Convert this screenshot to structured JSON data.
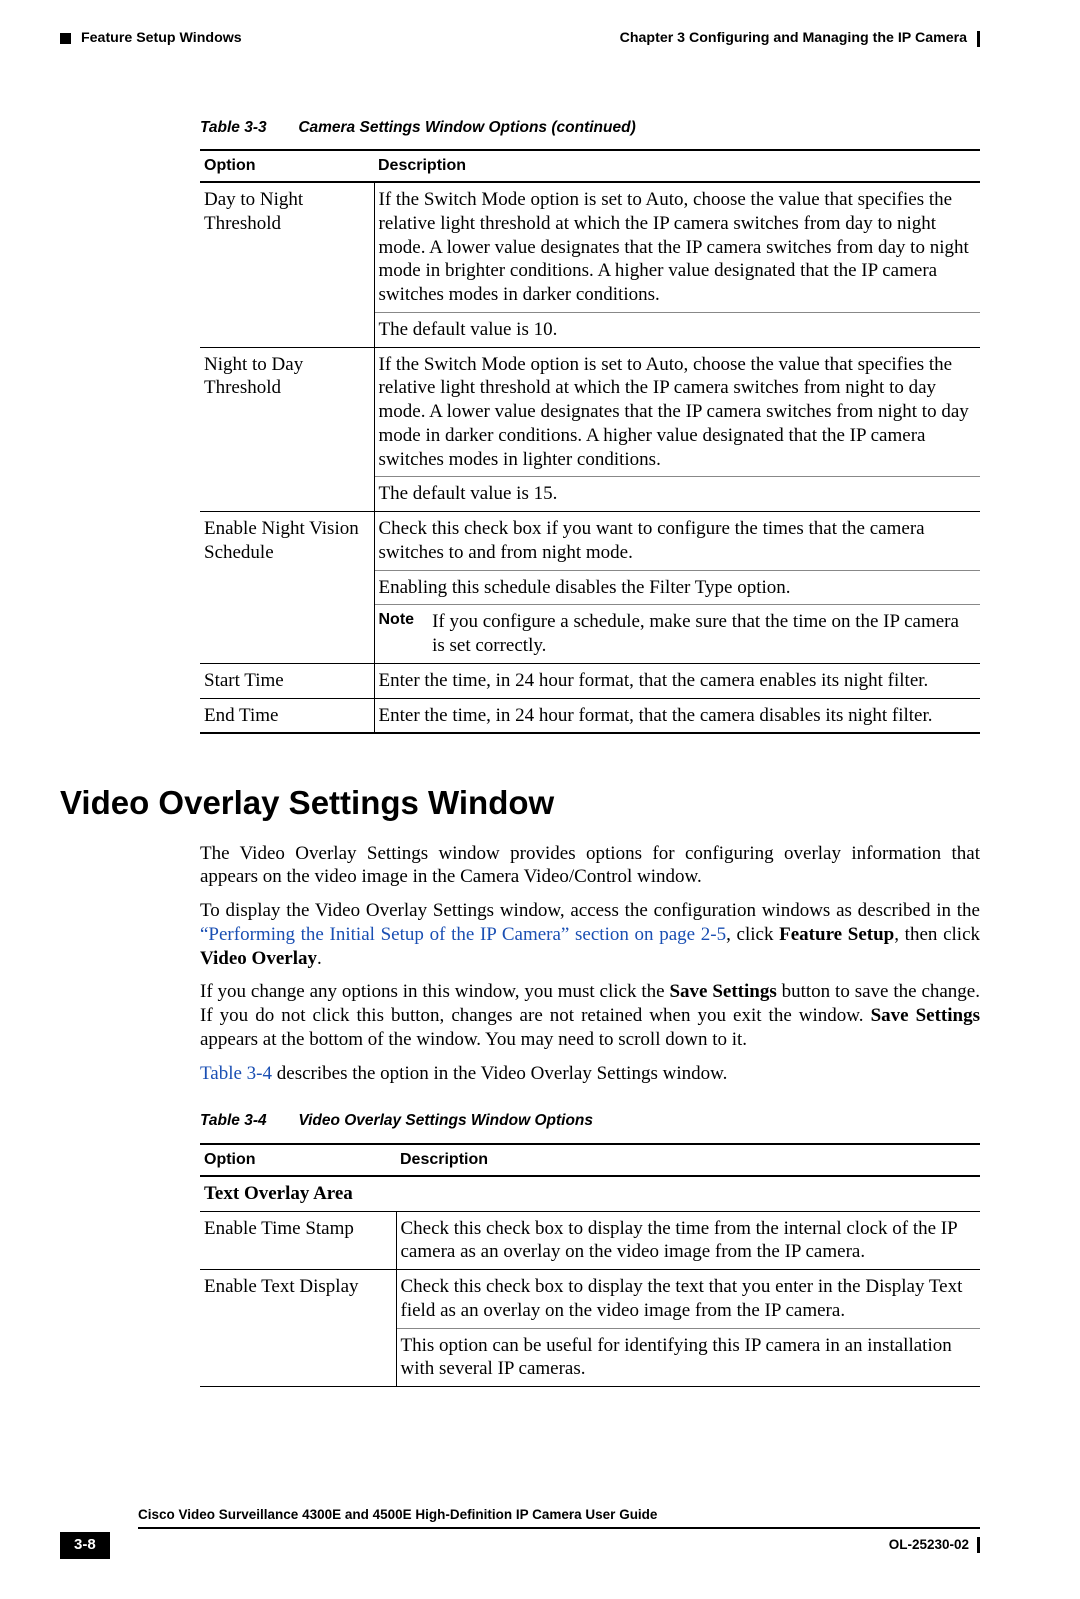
{
  "header": {
    "section": "Feature Setup Windows",
    "chapter": "Chapter 3      Configuring and Managing the IP Camera"
  },
  "table3_3": {
    "cap_num": "Table 3-3",
    "cap_title": "Camera Settings Window Options (continued)",
    "th_option": "Option",
    "th_desc": "Description",
    "rows": {
      "r0": {
        "opt": "Day to Night Threshold",
        "p1": "If the Switch Mode option is set to Auto, choose the value that specifies the relative light threshold at which the IP camera switches from day to night mode. A lower value designates that the IP camera switches from day to night mode in brighter conditions. A higher value designated that the IP camera switches modes in darker conditions.",
        "p2": "The default value is 10."
      },
      "r1": {
        "opt": "Night to Day Threshold",
        "p1": "If the Switch Mode option is set to Auto, choose the value that specifies the relative light threshold at which the IP camera switches from night to day mode. A lower value designates that the IP camera switches from night to day mode in darker conditions. A higher value designated that the IP camera switches modes in lighter conditions.",
        "p2": "The default value is 15."
      },
      "r2": {
        "opt": "Enable Night Vision Schedule",
        "p1": "Check this check box if you want to configure the times that the camera switches to and from night mode.",
        "p2": "Enabling this schedule disables the Filter Type option.",
        "note_lbl": "Note",
        "note_txt": "If you configure a schedule, make sure that the time on the IP camera is set correctly."
      },
      "r3": {
        "opt": "Start Time",
        "desc": "Enter the time, in 24 hour format, that the camera enables its night filter."
      },
      "r4": {
        "opt": "End Time",
        "desc": "Enter the time, in 24 hour format, that the camera disables its night filter."
      }
    }
  },
  "section2": {
    "title": "Video Overlay Settings Window",
    "p1": "The Video Overlay Settings window provides options for configuring overlay information that appears on the video image in the Camera Video/Control window.",
    "p2a": "To display the Video Overlay Settings window, access the configuration windows as described in the ",
    "p2_link": "“Performing the Initial Setup of the IP Camera” section on page 2-5",
    "p2b": ", click ",
    "p2_bold1": "Feature Setup",
    "p2c": ", then click ",
    "p2_bold2": "Video Overlay",
    "p2d": ".",
    "p3a": "If you change any options in this window, you must click the ",
    "p3_bold1": "Save Settings",
    "p3b": " button to save the change. If you do not click this button, changes are not retained when you exit the window. ",
    "p3_bold2": "Save Settings",
    "p3c": " appears at the bottom of the window. You may need to scroll down to it.",
    "p4_link": "Table 3-4",
    "p4_rest": " describes the option in the Video Overlay Settings window."
  },
  "table3_4": {
    "cap_num": "Table 3-4",
    "cap_title": "Video Overlay Settings Window Options",
    "th_option": "Option",
    "th_desc": "Description",
    "section_hdr": "Text Overlay Area",
    "rows": {
      "r0": {
        "opt": "Enable Time Stamp",
        "desc": "Check this check box to display the time from the internal clock of the IP camera as an overlay on the video image from the IP camera."
      },
      "r1": {
        "opt": "Enable Text Display",
        "p1": "Check this check box to display the text that you enter in the Display Text field as an overlay on the video image from the IP camera.",
        "p2": "This option can be useful for identifying this IP camera in an installation with several IP cameras."
      }
    }
  },
  "footer": {
    "book": "Cisco Video Surveillance 4300E and 4500E High-Definition IP Camera User Guide",
    "page": "3-8",
    "docnum": "OL-25230-02"
  }
}
